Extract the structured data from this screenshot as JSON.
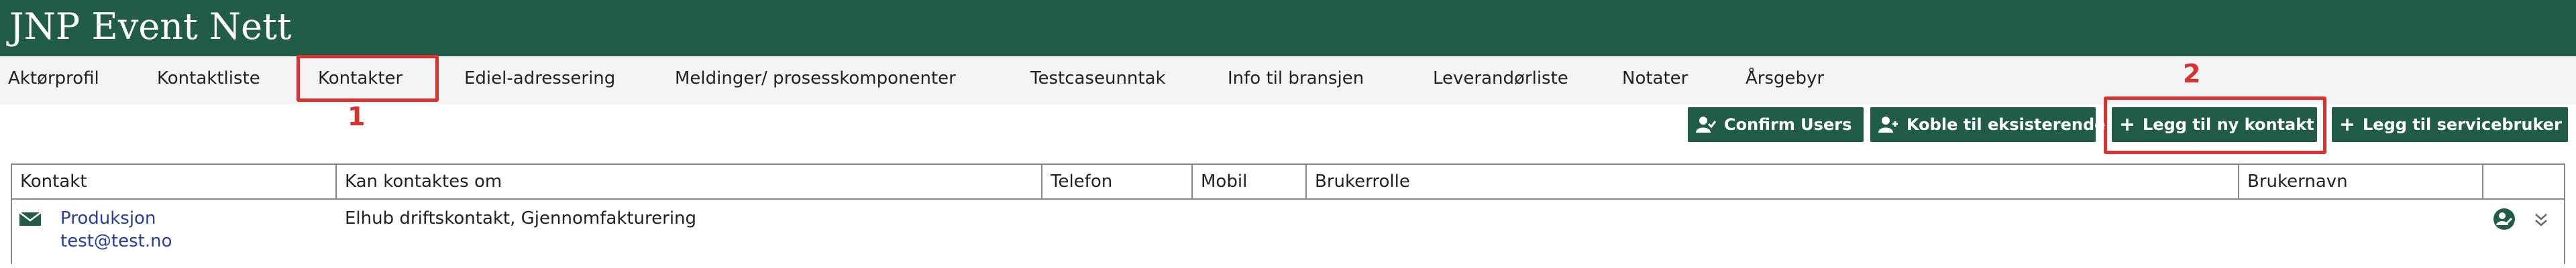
{
  "app": {
    "title": "JNP Event Nett"
  },
  "nav": {
    "items": [
      {
        "label": "Aktørprofil"
      },
      {
        "label": "Kontaktliste"
      },
      {
        "label": "Kontakter",
        "active": true
      },
      {
        "label": "Ediel-adressering"
      },
      {
        "label": "Meldinger/ prosesskomponenter"
      },
      {
        "label": "Testcaseunntak"
      },
      {
        "label": "Info til bransjen"
      },
      {
        "label": "Leverandørliste"
      },
      {
        "label": "Notater"
      },
      {
        "label": "Årsgebyr"
      }
    ]
  },
  "annotations": {
    "marker1": "1",
    "marker2": "2",
    "color": "#d9322e"
  },
  "toolbar": {
    "confirm_users": "Confirm Users",
    "koble": "Koble til eksisterende",
    "legg_ny_kontakt": "Legg til ny kontakt",
    "legg_servicebruker": "Legg til servicebruker"
  },
  "table": {
    "columns": [
      "Kontakt",
      "Kan kontaktes om",
      "Telefon",
      "Mobil",
      "Brukerrolle",
      "Brukernavn",
      ""
    ],
    "rows": [
      {
        "name": "Produksjon",
        "email": "test@test.no",
        "topics": "Elhub driftskontakt, Gjennomfakturering",
        "telefon": "",
        "mobil": "",
        "brukerrolle": "",
        "brukernavn": ""
      }
    ]
  },
  "colors": {
    "brand": "#215c47",
    "link": "#2a3f99",
    "nav_bg": "#f3f4f3"
  }
}
